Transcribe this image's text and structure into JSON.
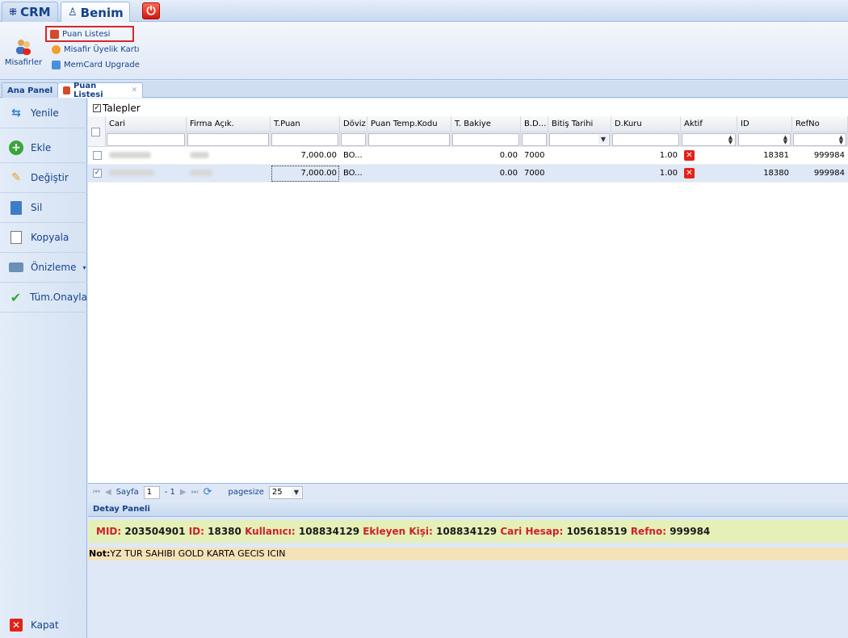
{
  "top_tabs": {
    "crm": "CRM",
    "benim": "Benim"
  },
  "ribbon": {
    "big_button": "Misafirler",
    "items": [
      "Puan Listesi",
      "Misafir Üyelik Kartı",
      "MemCard Upgrade"
    ]
  },
  "tabs": [
    {
      "label": "Ana Panel"
    },
    {
      "label": "Puan Listesi"
    }
  ],
  "toolbar": {
    "items": [
      "Yenile",
      "Ekle",
      "Değiştir",
      "Sil",
      "Kopyala",
      "Önizleme",
      "Tüm.Onayla"
    ],
    "kapat": "Kapat"
  },
  "grid": {
    "title": "Talepler",
    "columns": [
      "Cari",
      "Firma Açık.",
      "T.Puan",
      "Döviz",
      "Puan Temp.Kodu",
      "T. Bakiye",
      "B.D...",
      "Bitiş Tarihi",
      "D.Kuru",
      "Aktif",
      "ID",
      "RefNo"
    ],
    "rows": [
      {
        "t_puan": "7,000.00",
        "doviz": "BO...",
        "t_bakiye": "0.00",
        "bd": "7000",
        "d_kuru": "1.00",
        "id": "18381",
        "refno": "999984",
        "checked": ""
      },
      {
        "t_puan": "7,000.00",
        "doviz": "BO...",
        "t_bakiye": "0.00",
        "bd": "7000",
        "d_kuru": "1.00",
        "id": "18380",
        "refno": "999984",
        "checked": "✓"
      }
    ]
  },
  "pager": {
    "first": "⏮",
    "prev": "◀",
    "page_label": "Sayfa",
    "page_value": "1",
    "of_label": "- 1",
    "next": "▶",
    "last": "⏭",
    "refresh": "⟳",
    "pagesize_label": "pagesize",
    "pagesize_value": "25"
  },
  "detail": {
    "header": "Detay Paneli",
    "mid_label": "MID:",
    "mid": "203504901",
    "id_label": "ID:",
    "id": "18380",
    "user_label": "Kullanıcı:",
    "user": "108834129",
    "adder_label": "Ekleyen Kişi:",
    "adder": "108834129",
    "cari_label": "Cari Hesap:",
    "cari": "105618519",
    "refno_label": "Refno:",
    "refno": "999984",
    "note_label": "Not:",
    "note": "YZ TUR SAHIBI GOLD KARTA GECIS ICIN"
  },
  "colors": {
    "accent": "#15428b",
    "close_red": "#e2231a",
    "detail_highlight": "#e5f0b8",
    "note_highlight": "#f4e2b8"
  }
}
